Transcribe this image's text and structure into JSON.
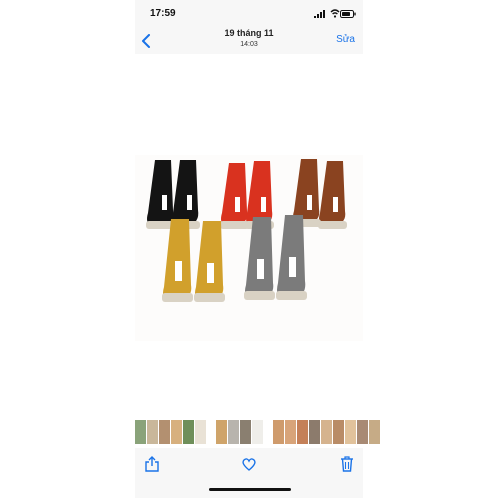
{
  "status_bar": {
    "time": "17:59"
  },
  "nav": {
    "title": "19 tháng 11",
    "subtitle": "14:03",
    "edit_label": "Sửa"
  },
  "accent_color": "#1a73e8",
  "icons": [
    "chevron-left-icon",
    "share-icon",
    "heart-icon",
    "trash-icon",
    "signal-icon",
    "wifi-icon",
    "battery-icon"
  ],
  "photo": {
    "sock_colors": [
      "#141414",
      "#d9321f",
      "#8a4320",
      "#d1a02c",
      "#7b7b7b"
    ],
    "sole_color": "#d9d2c4"
  },
  "thumbnails": [
    "#8aa37a",
    "#c9b79a",
    "#b39070",
    "#d7b07e",
    "#6f8f5a",
    "#e9e2d6",
    "#cfa46a",
    "#b8b4ad",
    "#8a7f70",
    "#efeeea",
    "#cf9b6c",
    "#d8a479",
    "#c48058",
    "#8c7b6c",
    "#d5b38e",
    "#b98c67",
    "#e1c29b",
    "#a88a74",
    "#c6ab86"
  ]
}
